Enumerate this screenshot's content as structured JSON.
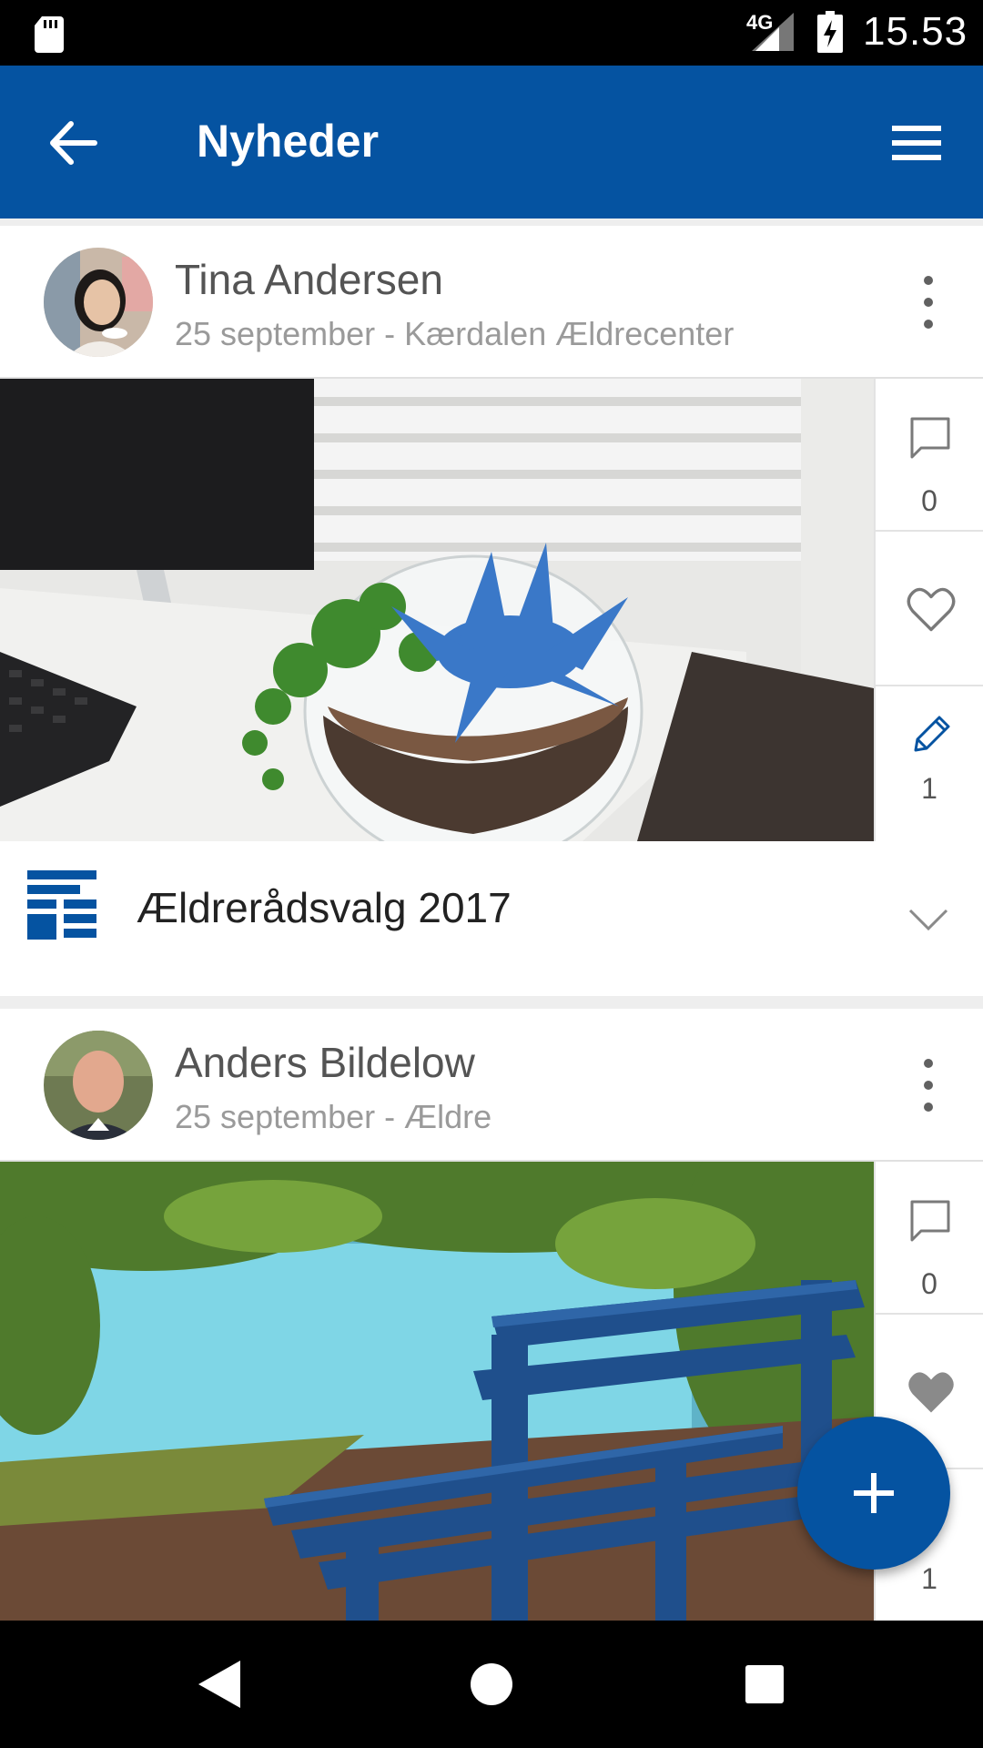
{
  "status_bar": {
    "network": "4G",
    "time": "15.53"
  },
  "app_bar": {
    "title": "Nyheder",
    "back_icon": "arrow-back-icon",
    "menu_icon": "hamburger-menu-icon"
  },
  "posts": [
    {
      "author": "Tina Andersen",
      "meta": "25 september - Kærdalen Ældrecenter",
      "comments": "0",
      "edits": "1",
      "section_title": "Ældrerådsvalg 2017"
    },
    {
      "author": "Anders Bildelow",
      "meta": "25 september - Ældre",
      "comments": "0",
      "edits": "1"
    }
  ],
  "colors": {
    "primary": "#0553a1",
    "background": "#eeeeee",
    "text_secondary": "#9a9a9a"
  },
  "fab": {
    "icon": "plus-icon"
  }
}
